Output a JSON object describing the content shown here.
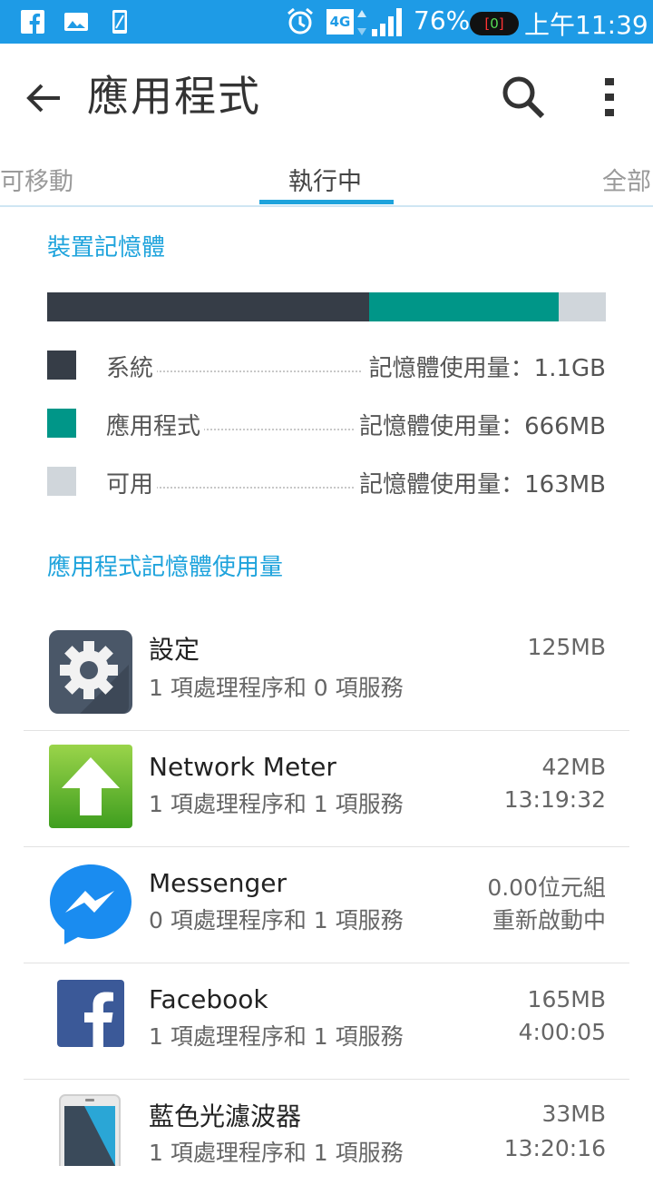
{
  "status_bar": {
    "icons": [
      "facebook-icon",
      "gallery-icon",
      "phone-icon",
      "alarm-icon",
      "4g-icon",
      "signal-icon"
    ],
    "network": "4G",
    "battery": "76%",
    "toggle": "0",
    "time": "上午11:39"
  },
  "header": {
    "title": "應用程式"
  },
  "tabs": [
    {
      "label": "可移動"
    },
    {
      "label": "執行中"
    },
    {
      "label": "全部"
    }
  ],
  "device_memory": {
    "title": "裝置記憶體",
    "segments_fraction": [
      0.576,
      0.339,
      0.085
    ],
    "colors": {
      "system": "#363d47",
      "apps": "#009688",
      "free": "#d0d6db"
    },
    "legend": [
      {
        "label": "系統",
        "value": "記憶體使用量：1.1GB"
      },
      {
        "label": "應用程式",
        "value": "記憶體使用量：666MB"
      },
      {
        "label": "可用",
        "value": "記憶體使用量：163MB"
      }
    ]
  },
  "app_memory": {
    "title": "應用程式記憶體使用量",
    "apps": [
      {
        "name": "設定",
        "sub": "1 項處理程序和 0 項服務",
        "size": "125MB",
        "time": "",
        "icon": "settings-gear-icon"
      },
      {
        "name": "Network Meter",
        "sub": "1 項處理程序和 1 項服務",
        "size": "42MB",
        "time": "13:19:32",
        "icon": "network-meter-icon"
      },
      {
        "name": "Messenger",
        "sub": "0 項處理程序和 1 項服務",
        "size": "0.00位元組",
        "time": "重新啟動中",
        "icon": "messenger-icon"
      },
      {
        "name": "Facebook",
        "sub": "1 項處理程序和 1 項服務",
        "size": "165MB",
        "time": "4:00:05",
        "icon": "facebook-icon"
      },
      {
        "name": "藍色光濾波器",
        "sub": "1 項處理程序和 1 項服務",
        "size": "33MB",
        "time": "13:20:16",
        "icon": "blue-light-filter-icon"
      }
    ]
  }
}
